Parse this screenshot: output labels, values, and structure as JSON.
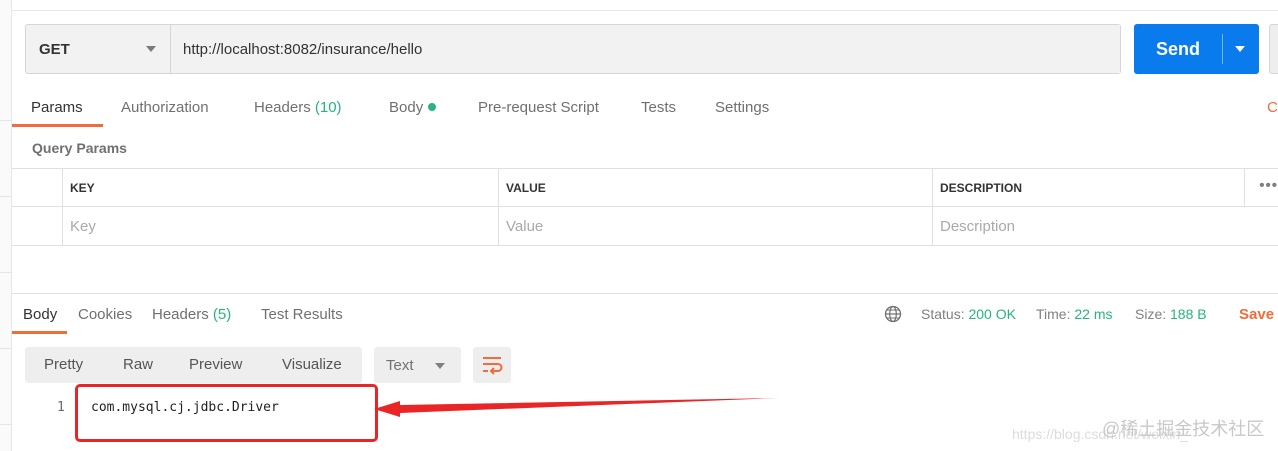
{
  "request": {
    "method": "GET",
    "url": "http://localhost:8082/insurance/hello",
    "send_label": "Send"
  },
  "request_tabs": {
    "params": "Params",
    "authorization": "Authorization",
    "headers": "Headers",
    "headers_count": "(10)",
    "body": "Body",
    "pre_request": "Pre-request Script",
    "tests": "Tests",
    "settings": "Settings",
    "cookies_edge": "C"
  },
  "query_params": {
    "title": "Query Params",
    "columns": [
      "KEY",
      "VALUE",
      "DESCRIPTION"
    ],
    "placeholders": [
      "Key",
      "Value",
      "Description"
    ],
    "more": "•••"
  },
  "response_tabs": {
    "body": "Body",
    "cookies": "Cookies",
    "headers": "Headers",
    "headers_count": "(5)",
    "test_results": "Test Results"
  },
  "response_status": {
    "status_label": "Status:",
    "status_value": "200 OK",
    "time_label": "Time:",
    "time_value": "22 ms",
    "size_label": "Size:",
    "size_value": "188 B",
    "save_label": "Save"
  },
  "response_toolbar": {
    "views": [
      "Pretty",
      "Raw",
      "Preview",
      "Visualize"
    ],
    "format": "Text"
  },
  "response_body": {
    "line_number": "1",
    "content": "com.mysql.cj.jdbc.Driver"
  },
  "watermark": {
    "brand": "@稀土掘金技术社区",
    "url": "https://blog.csdn.net/weixin_"
  },
  "colors": {
    "accent_orange": "#f26b3a",
    "send_blue": "#097bed",
    "success_green": "#26b47f",
    "annotation_red": "#ea2525"
  }
}
